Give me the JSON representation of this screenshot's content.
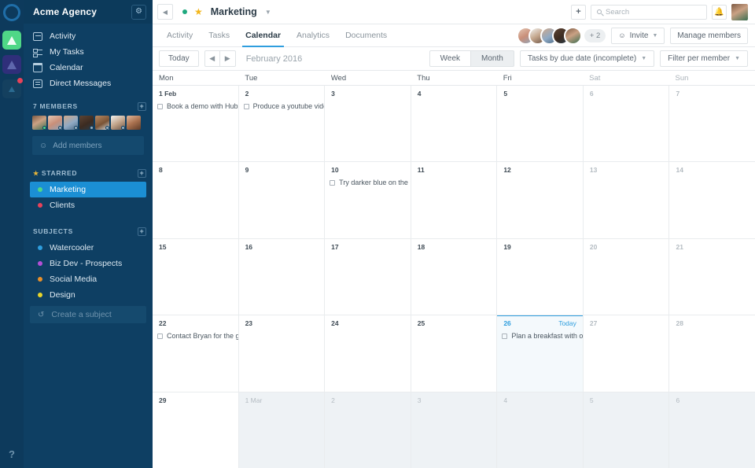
{
  "rail": {
    "logo": "circle-logo",
    "workspaces": [
      {
        "name": "workspace-green",
        "color": "#4fd787",
        "badge": false
      },
      {
        "name": "workspace-purple",
        "color": "#2f2f7a",
        "badge": false
      },
      {
        "name": "workspace-dark",
        "color": "#14405f",
        "badge": true
      }
    ],
    "help_label": "?"
  },
  "sidebar": {
    "org_title": "Acme Agency",
    "settings_icon": "gear-icon",
    "nav": [
      {
        "label": "Activity",
        "icon": "activity-icon"
      },
      {
        "label": "My Tasks",
        "icon": "tasks-icon"
      },
      {
        "label": "Calendar",
        "icon": "calendar-icon"
      },
      {
        "label": "Direct Messages",
        "icon": "messages-icon"
      }
    ],
    "members_section": {
      "label": "7 MEMBERS",
      "add_icon": "plus-icon",
      "avatar_count": 7,
      "add_members_label": "Add members",
      "add_members_icon": "add-person-icon"
    },
    "starred_section": {
      "label": "STARRED",
      "star_icon": "star-icon",
      "add_icon": "plus-icon",
      "items": [
        {
          "label": "Marketing",
          "color": "#4fd787",
          "active": true
        },
        {
          "label": "Clients",
          "color": "#e8425a",
          "active": false
        }
      ]
    },
    "subjects_section": {
      "label": "SUBJECTS",
      "add_icon": "plus-icon",
      "items": [
        {
          "label": "Watercooler",
          "color": "#2f9ede"
        },
        {
          "label": "Biz Dev - Prospects",
          "color": "#b44fd7"
        },
        {
          "label": "Social Media",
          "color": "#e8902a"
        },
        {
          "label": "Design",
          "color": "#e8d42a"
        }
      ],
      "create_label": "Create a subject",
      "create_icon": "refresh-icon"
    }
  },
  "topbar": {
    "back_icon": "chevron-left-icon",
    "status_dot": "#1fa97f",
    "star_icon": "star-icon",
    "project_name": "Marketing",
    "caret_icon": "chevron-down-icon",
    "add_icon": "plus-icon",
    "search_placeholder": "Search",
    "search_value": "",
    "search_icon": "search-icon",
    "bell_icon": "bell-icon",
    "user_avatar": "avatar"
  },
  "tabs": [
    {
      "label": "Activity",
      "active": false
    },
    {
      "label": "Tasks",
      "active": false
    },
    {
      "label": "Calendar",
      "active": true
    },
    {
      "label": "Analytics",
      "active": false
    },
    {
      "label": "Documents",
      "active": false
    }
  ],
  "tabbar_right": {
    "avatar_stack_count": 5,
    "overflow_label": "+ 2",
    "invite_label": "Invite",
    "invite_icon": "add-person-icon",
    "invite_caret": "chevron-down-icon",
    "manage_label": "Manage members"
  },
  "toolbar": {
    "today_label": "Today",
    "prev_icon": "chevron-left-icon",
    "next_icon": "chevron-right-icon",
    "month_label": "February 2016",
    "view_week": "Week",
    "view_month": "Month",
    "view_active": "Month",
    "filter_tasks_label": "Tasks by due date (incomplete)",
    "filter_member_label": "Filter per member",
    "caret_icon": "chevron-down-icon"
  },
  "calendar": {
    "weekdays": [
      {
        "label": "Mon",
        "weekend": false
      },
      {
        "label": "Tue",
        "weekend": false
      },
      {
        "label": "Wed",
        "weekend": false
      },
      {
        "label": "Thu",
        "weekend": false
      },
      {
        "label": "Fri",
        "weekend": false
      },
      {
        "label": "Sat",
        "weekend": true
      },
      {
        "label": "Sun",
        "weekend": true
      }
    ],
    "today_tag": "Today",
    "weeks": [
      [
        {
          "num": "1 Feb",
          "tasks": [
            "Book a demo with Hubspot"
          ]
        },
        {
          "num": "2",
          "tasks": [
            "Produce a youtube video for"
          ]
        },
        {
          "num": "3",
          "tasks": []
        },
        {
          "num": "4",
          "tasks": []
        },
        {
          "num": "5",
          "tasks": []
        },
        {
          "num": "6",
          "weekend": true,
          "tasks": []
        },
        {
          "num": "7",
          "weekend": true,
          "tasks": []
        }
      ],
      [
        {
          "num": "8",
          "tasks": []
        },
        {
          "num": "9",
          "tasks": []
        },
        {
          "num": "10",
          "tasks": [
            "Try darker blue on the mobil"
          ]
        },
        {
          "num": "11",
          "tasks": []
        },
        {
          "num": "12",
          "tasks": []
        },
        {
          "num": "13",
          "weekend": true,
          "tasks": []
        },
        {
          "num": "14",
          "weekend": true,
          "tasks": []
        }
      ],
      [
        {
          "num": "15",
          "tasks": []
        },
        {
          "num": "16",
          "tasks": []
        },
        {
          "num": "17",
          "tasks": []
        },
        {
          "num": "18",
          "tasks": []
        },
        {
          "num": "19",
          "tasks": []
        },
        {
          "num": "20",
          "weekend": true,
          "tasks": []
        },
        {
          "num": "21",
          "weekend": true,
          "tasks": []
        }
      ],
      [
        {
          "num": "22",
          "tasks": [
            "Contact Bryan for the greetin"
          ]
        },
        {
          "num": "23",
          "tasks": []
        },
        {
          "num": "24",
          "tasks": []
        },
        {
          "num": "25",
          "tasks": []
        },
        {
          "num": "26",
          "today": true,
          "tasks": [
            "Plan a breakfast with our pa"
          ]
        },
        {
          "num": "27",
          "weekend": true,
          "tasks": []
        },
        {
          "num": "28",
          "weekend": true,
          "tasks": []
        }
      ],
      [
        {
          "num": "29",
          "tasks": []
        },
        {
          "num": "1 Mar",
          "other": true,
          "tasks": []
        },
        {
          "num": "2",
          "other": true,
          "tasks": []
        },
        {
          "num": "3",
          "other": true,
          "tasks": []
        },
        {
          "num": "4",
          "other": true,
          "tasks": []
        },
        {
          "num": "5",
          "other": true,
          "tasks": []
        },
        {
          "num": "6",
          "other": true,
          "tasks": []
        }
      ]
    ]
  }
}
